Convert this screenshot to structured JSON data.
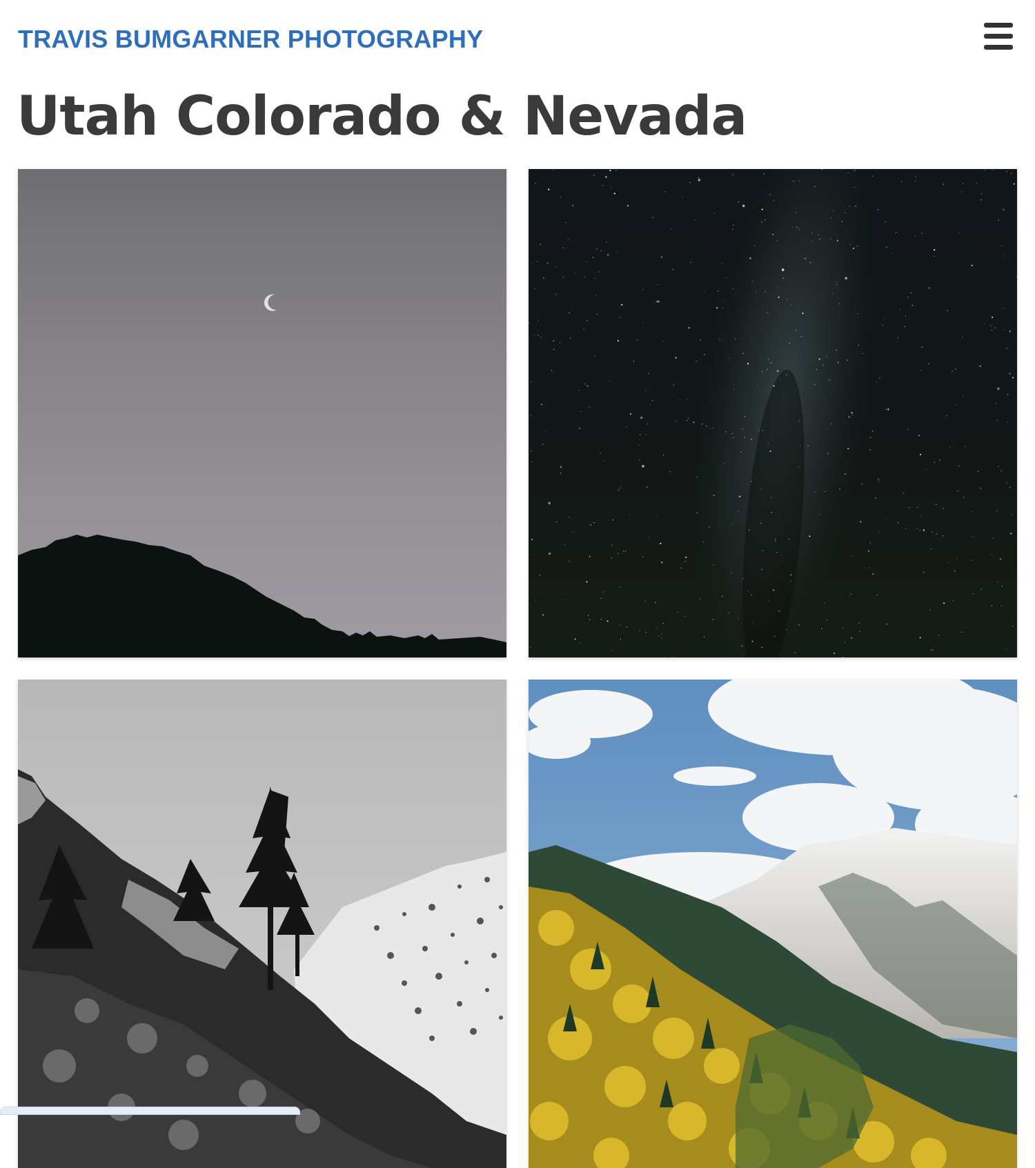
{
  "header": {
    "site_title": "TRAVIS BUMGARNER PHOTOGRAPHY",
    "menu_icon": "hamburger-icon"
  },
  "page": {
    "title": "Utah Colorado & Nevada"
  },
  "gallery": {
    "photos": [
      {
        "subject": "crescent moon over dark hillside silhouette"
      },
      {
        "subject": "milky way night sky"
      },
      {
        "subject": "black and white pine trees on rocky slopes"
      },
      {
        "subject": "autumn aspens below snowy mountain peaks"
      }
    ]
  },
  "colors": {
    "title_blue": "#2f6fba",
    "heading_gray": "#3a3a3a",
    "menu_icon": "#333333"
  }
}
